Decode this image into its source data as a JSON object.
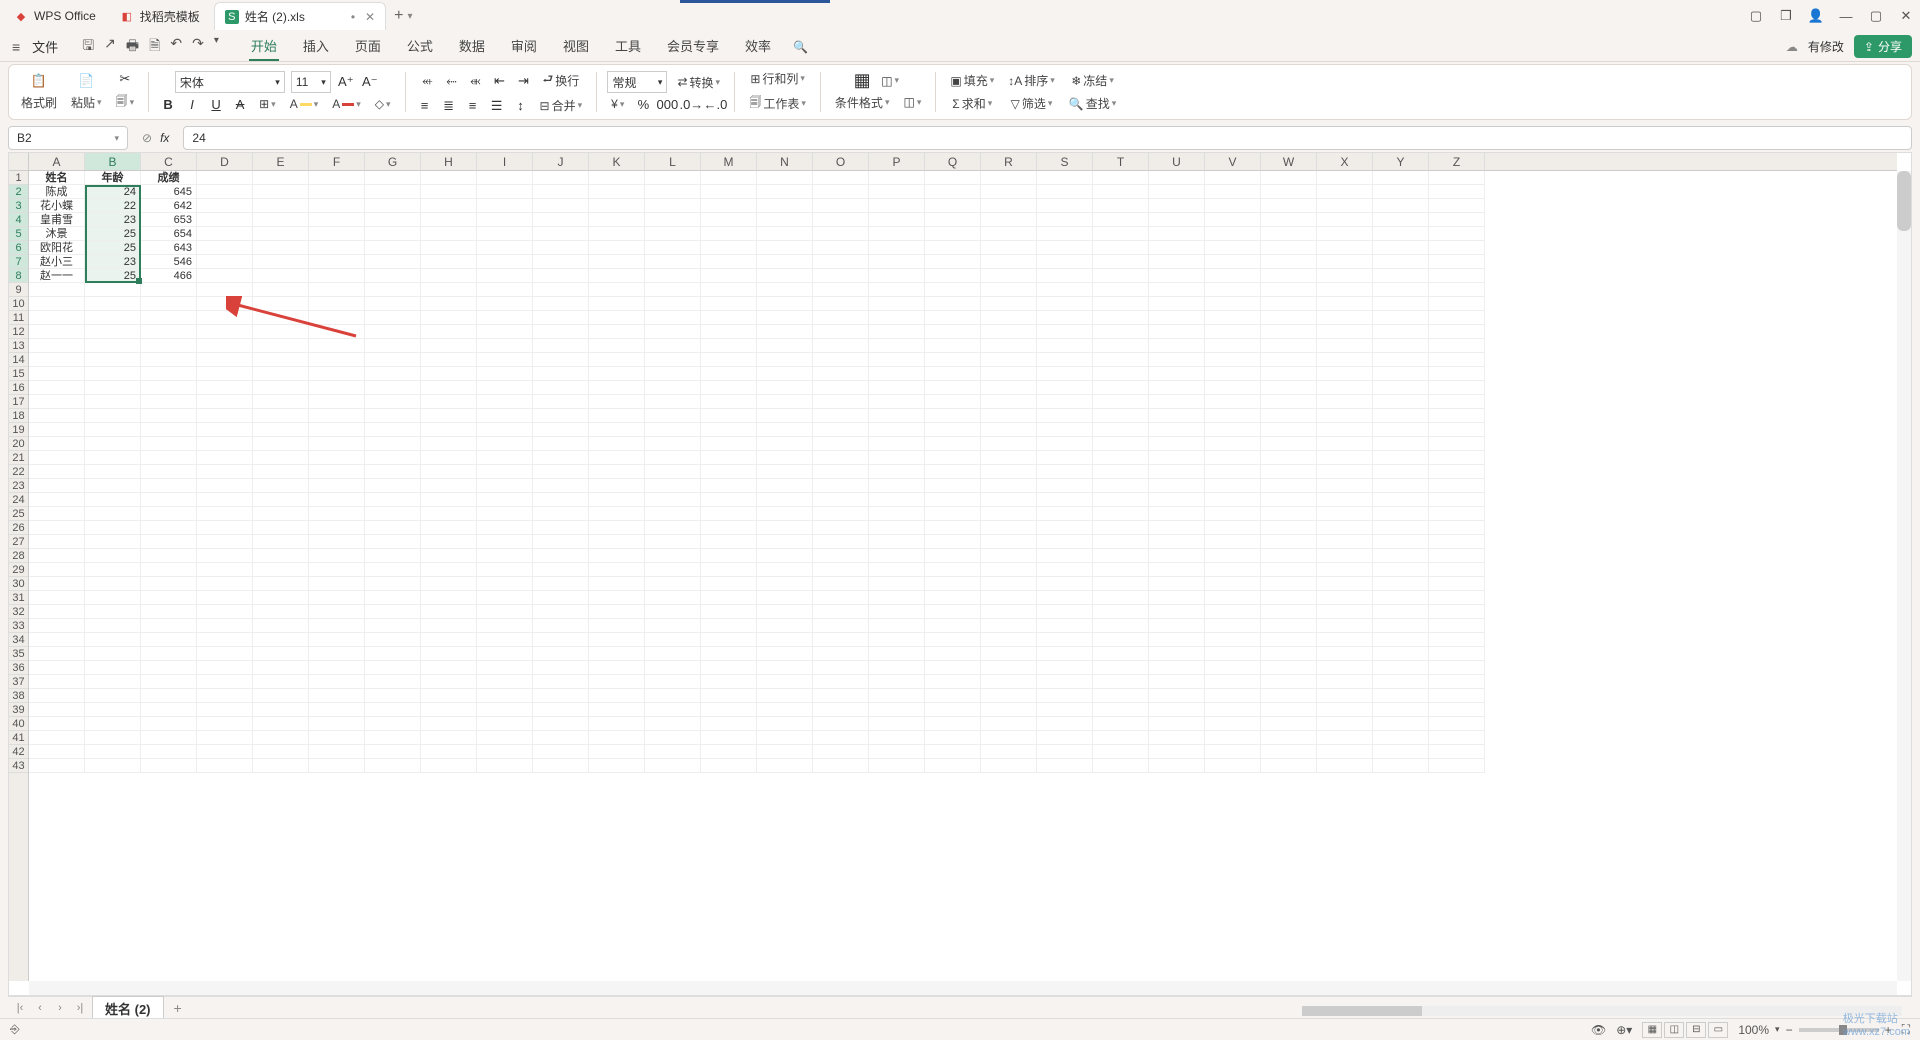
{
  "titlebar": {
    "app_name": "WPS Office",
    "tab2": "找稻壳模板",
    "doc_tab": "姓名 (2).xls",
    "modified": "•"
  },
  "menubar": {
    "file": "文件",
    "tabs": [
      "开始",
      "插入",
      "页面",
      "公式",
      "数据",
      "审阅",
      "视图",
      "工具",
      "会员专享",
      "效率"
    ],
    "pending": "有修改",
    "share": "分享"
  },
  "ribbon": {
    "format_painter": "格式刷",
    "paste": "粘贴",
    "font_name": "宋体",
    "font_size": "11",
    "wrap": "换行",
    "merge": "合并",
    "number_format": "常规",
    "convert": "转换",
    "row_col": "行和列",
    "worksheet": "工作表",
    "cond_format": "条件格式",
    "fill": "填充",
    "sort": "排序",
    "freeze": "冻结",
    "sum": "求和",
    "filter": "筛选",
    "find": "查找"
  },
  "formula": {
    "cell_ref": "B2",
    "fx": "fx",
    "value": "24"
  },
  "columns": [
    "A",
    "B",
    "C",
    "D",
    "E",
    "F",
    "G",
    "H",
    "I",
    "J",
    "K",
    "L",
    "M",
    "N",
    "O",
    "P",
    "Q",
    "R",
    "S",
    "T",
    "U",
    "V",
    "W",
    "X",
    "Y",
    "Z"
  ],
  "row_count": 43,
  "headers": [
    "姓名",
    "年龄",
    "成绩"
  ],
  "data_rows": [
    {
      "name": "陈成",
      "age": "24",
      "score": "645"
    },
    {
      "name": "花小蝶",
      "age": "22",
      "score": "642"
    },
    {
      "name": "皇甫雪",
      "age": "23",
      "score": "653"
    },
    {
      "name": "沐景",
      "age": "25",
      "score": "654"
    },
    {
      "name": "欧阳花",
      "age": "25",
      "score": "643"
    },
    {
      "name": "赵小三",
      "age": "23",
      "score": "546"
    },
    {
      "name": "赵一一",
      "age": "25",
      "score": "466"
    }
  ],
  "selected_column": "B",
  "selected_rows": [
    2,
    3,
    4,
    5,
    6,
    7,
    8
  ],
  "sheet_tabs": {
    "active": "姓名 (2)"
  },
  "status": {
    "zoom": "100%",
    "watermark": "极光下载站",
    "watermark_url": "www.xz7.com"
  }
}
